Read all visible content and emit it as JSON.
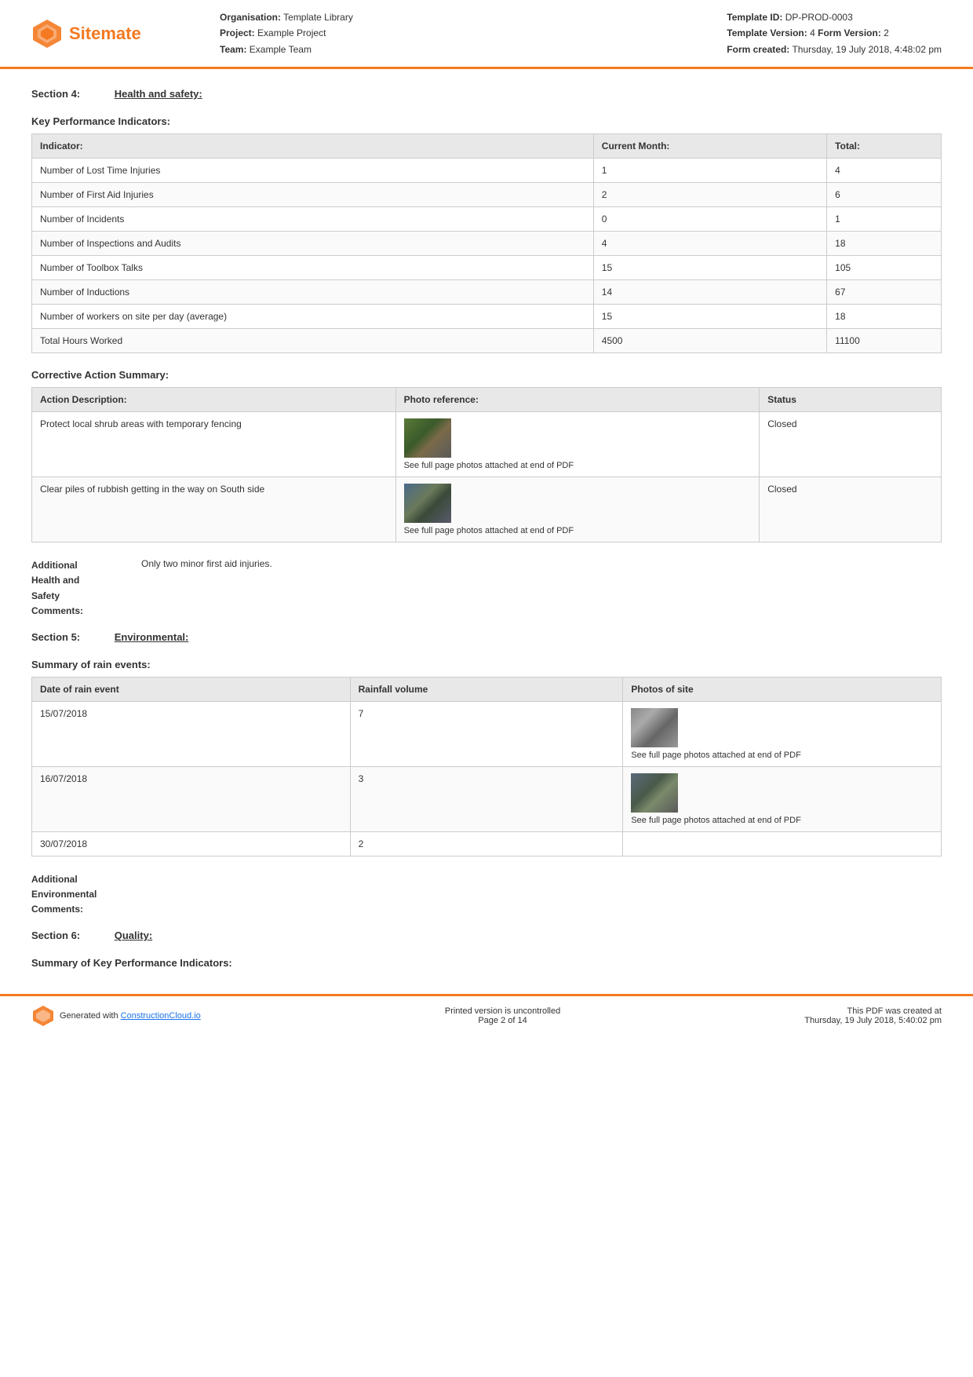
{
  "header": {
    "logo_text": "Sitemate",
    "org_label": "Organisation:",
    "org_value": "Template Library",
    "project_label": "Project:",
    "project_value": "Example Project",
    "team_label": "Team:",
    "team_value": "Example Team",
    "template_id_label": "Template ID:",
    "template_id_value": "DP-PROD-0003",
    "template_version_label": "Template Version:",
    "template_version_value": "4",
    "form_version_label": "Form Version:",
    "form_version_value": "2",
    "form_created_label": "Form created:",
    "form_created_value": "Thursday, 19 July 2018, 4:48:02 pm"
  },
  "section4": {
    "label": "Section 4:",
    "title": "Health and safety:",
    "kpi_heading": "Key Performance Indicators:",
    "kpi_table": {
      "headers": [
        "Indicator:",
        "Current Month:",
        "Total:"
      ],
      "rows": [
        [
          "Number of Lost Time Injuries",
          "1",
          "4"
        ],
        [
          "Number of First Aid Injuries",
          "2",
          "6"
        ],
        [
          "Number of Incidents",
          "0",
          "1"
        ],
        [
          "Number of Inspections and Audits",
          "4",
          "18"
        ],
        [
          "Number of Toolbox Talks",
          "15",
          "105"
        ],
        [
          "Number of Inductions",
          "14",
          "67"
        ],
        [
          "Number of workers on site per day (average)",
          "15",
          "18"
        ],
        [
          "Total Hours Worked",
          "4500",
          "11100"
        ]
      ]
    },
    "corrective_heading": "Corrective Action Summary:",
    "corrective_table": {
      "headers": [
        "Action Description:",
        "Photo reference:",
        "Status"
      ],
      "rows": [
        {
          "description": "Protect local shrub areas with temporary fencing",
          "photo_caption": "See full page photos attached at end of PDF",
          "photo_class": "forest",
          "status": "Closed"
        },
        {
          "description": "Clear piles of rubbish getting in the way on South side",
          "photo_caption": "See full page photos attached at end of PDF",
          "photo_class": "rubbish",
          "status": "Closed"
        }
      ]
    },
    "comment_label": "Additional\nHealth and\nSafety\nComments:",
    "comment_value": "Only two minor first aid injuries."
  },
  "section5": {
    "label": "Section 5:",
    "title": "Environmental:",
    "rain_heading": "Summary of rain events:",
    "rain_table": {
      "headers": [
        "Date of rain event",
        "Rainfall volume",
        "Photos of site"
      ],
      "rows": [
        {
          "date": "15/07/2018",
          "volume": "7",
          "photo_caption": "See full page photos attached at end of PDF",
          "photo_class": "rain1",
          "has_photo": true
        },
        {
          "date": "16/07/2018",
          "volume": "3",
          "photo_caption": "See full page photos attached at end of PDF",
          "photo_class": "rain2",
          "has_photo": true
        },
        {
          "date": "30/07/2018",
          "volume": "2",
          "photo_caption": "",
          "photo_class": "",
          "has_photo": false
        }
      ]
    },
    "comment_label": "Additional\nEnvironmental\nComments:",
    "comment_value": ""
  },
  "section6": {
    "label": "Section 6:",
    "title": "Quality:",
    "kpi_heading": "Summary of Key Performance Indicators:"
  },
  "footer": {
    "generated_text": "Generated with",
    "link_text": "ConstructionCloud.io",
    "uncontrolled_text": "Printed version is uncontrolled",
    "page_text": "Page 2 of 14",
    "pdf_created_text": "This PDF was created at",
    "pdf_created_date": "Thursday, 19 July 2018, 5:40:02 pm"
  }
}
